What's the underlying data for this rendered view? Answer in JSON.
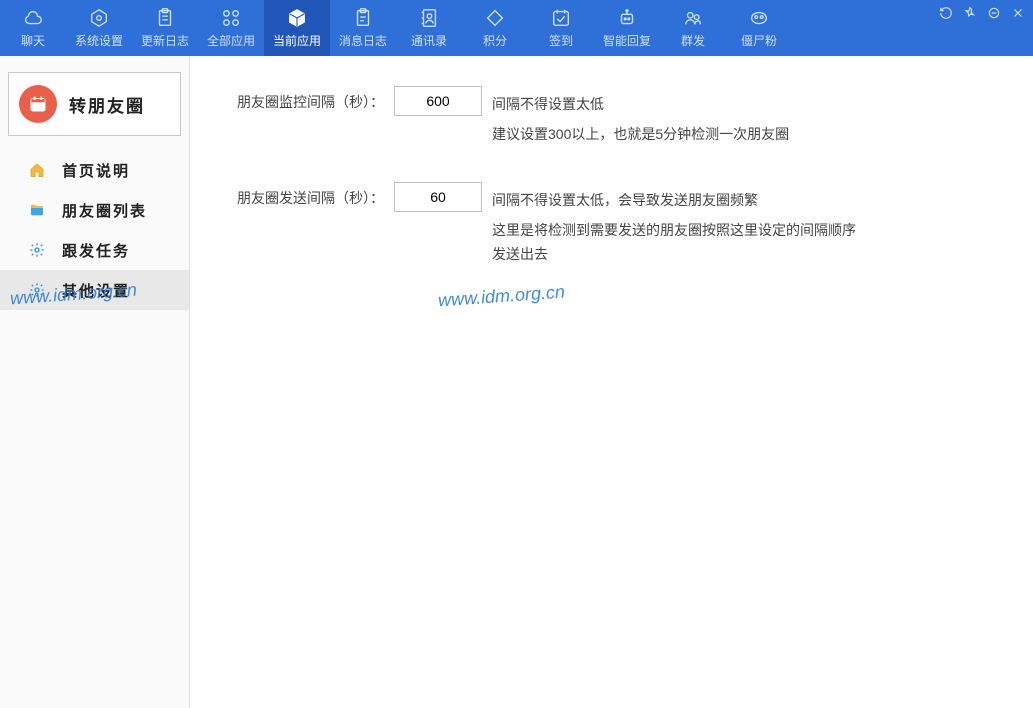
{
  "toolbar": {
    "items": [
      {
        "label": "聊天"
      },
      {
        "label": "系统设置"
      },
      {
        "label": "更新日志"
      },
      {
        "label": "全部应用"
      },
      {
        "label": "当前应用"
      },
      {
        "label": "消息日志"
      },
      {
        "label": "通讯录"
      },
      {
        "label": "积分"
      },
      {
        "label": "签到"
      },
      {
        "label": "智能回复"
      },
      {
        "label": "群发"
      },
      {
        "label": "僵尸粉"
      }
    ]
  },
  "sidebar": {
    "header_title": "转朋友圈",
    "items": [
      {
        "label": "首页说明"
      },
      {
        "label": "朋友圈列表"
      },
      {
        "label": "跟发任务"
      },
      {
        "label": "其他设置"
      }
    ]
  },
  "form": {
    "monitor": {
      "label": "朋友圈监控间隔（秒）：",
      "value": "600",
      "hint1": "间隔不得设置太低",
      "hint2": "建议设置300以上，也就是5分钟检测一次朋友圈"
    },
    "send": {
      "label": "朋友圈发送间隔（秒）：",
      "value": "60",
      "hint1": "间隔不得设置太低，会导致发送朋友圈频繁",
      "hint2": "这里是将检测到需要发送的朋友圈按照这里设定的间隔顺序发送出去"
    }
  },
  "watermark": "www.idm.org.cn"
}
